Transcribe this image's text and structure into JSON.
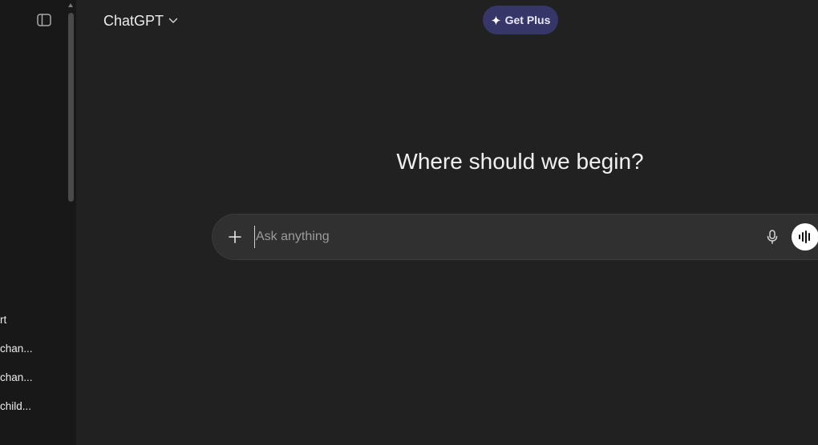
{
  "header": {
    "model_name": "ChatGPT",
    "get_plus_label": "Get Plus"
  },
  "main": {
    "headline": "Where should we begin?"
  },
  "composer": {
    "placeholder": "Ask anything"
  },
  "sidebar": {
    "history": [
      {
        "label": "rt"
      },
      {
        "label": "chan..."
      },
      {
        "label": "chan..."
      },
      {
        "label": "child..."
      }
    ]
  },
  "icons": {
    "sidebar_toggle": "sidebar-toggle-icon",
    "model_chevron": "chevron-down-icon",
    "get_plus": "sparkle-icon",
    "attach": "plus-icon",
    "dictate": "microphone-icon",
    "voice_mode": "waveform-icon"
  },
  "colors": {
    "background": "#212121",
    "sidebar": "#181818",
    "composer": "#303030",
    "get_plus_bg": "#373669"
  }
}
